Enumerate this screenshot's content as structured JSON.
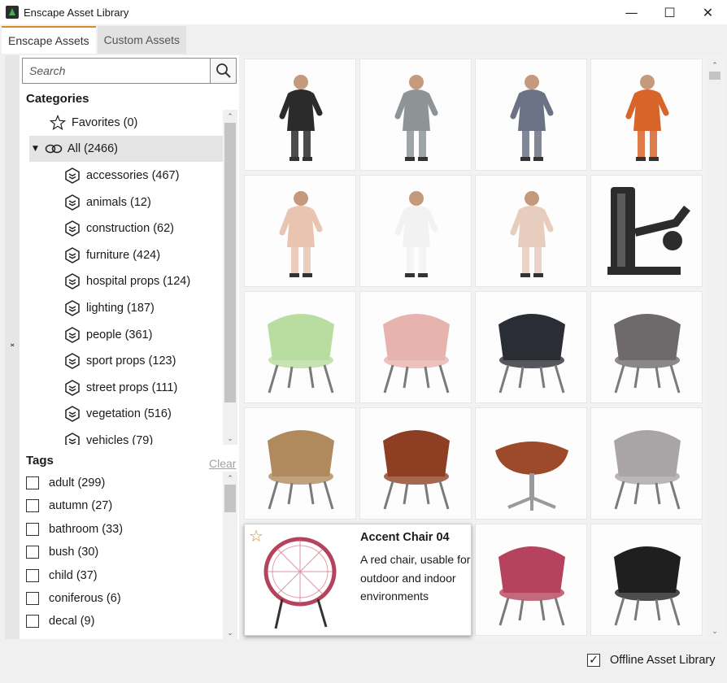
{
  "window": {
    "title": "Enscape Asset Library",
    "controls": {
      "minimize": "—",
      "maximize": "☐",
      "close": "✕"
    }
  },
  "tabs": [
    {
      "label": "Enscape Assets",
      "active": true
    },
    {
      "label": "Custom Assets",
      "active": false
    }
  ],
  "search": {
    "placeholder": "Search",
    "value": "",
    "icon": "search-icon"
  },
  "categories": {
    "heading": "Categories",
    "favorites": "Favorites (0)",
    "all": "All (2466)",
    "items": [
      "accessories (467)",
      "animals (12)",
      "construction (62)",
      "furniture (424)",
      "hospital props (124)",
      "lighting (187)",
      "people (361)",
      "sport props (123)",
      "street props (111)",
      "vegetation (516)",
      "vehicles (79)"
    ]
  },
  "tags": {
    "heading": "Tags",
    "clear_label": "Clear",
    "items": [
      "adult (299)",
      "autumn (27)",
      "bathroom (33)",
      "bush (30)",
      "child (37)",
      "coniferous (6)",
      "decal (9)"
    ]
  },
  "assets": [
    {
      "kind": "person",
      "color": "#2b2b2b"
    },
    {
      "kind": "person",
      "color": "#8e9496"
    },
    {
      "kind": "person",
      "color": "#6b7285"
    },
    {
      "kind": "person",
      "color": "#d8642a"
    },
    {
      "kind": "person",
      "color": "#e9c4b0"
    },
    {
      "kind": "person",
      "color": "#f2f2f2"
    },
    {
      "kind": "person",
      "color": "#e6cdbd"
    },
    {
      "kind": "machine",
      "color": "#2c2c2c"
    },
    {
      "kind": "chair",
      "color": "#b9dca0"
    },
    {
      "kind": "chair",
      "color": "#e6b3ae"
    },
    {
      "kind": "chair",
      "color": "#2a2d35"
    },
    {
      "kind": "chair",
      "color": "#6e6a6c"
    },
    {
      "kind": "chair",
      "color": "#b0895c"
    },
    {
      "kind": "chair",
      "color": "#8e3e22"
    },
    {
      "kind": "ottoman",
      "color": "#9c4a2a"
    },
    {
      "kind": "chair",
      "color": "#a9a5a6"
    },
    {
      "kind": "chair",
      "color": "#b5435d"
    },
    {
      "kind": "chair",
      "color": "#1f1f1f"
    },
    {
      "kind": "chair",
      "color": "#d2b47a"
    }
  ],
  "expanded_asset": {
    "title": "Accent Chair 04",
    "description": "A red chair, usable for outdoor and indoor environments",
    "favorite_icon": "star-icon"
  },
  "footer": {
    "offline_label": "Offline Asset Library",
    "offline_checked": true
  }
}
